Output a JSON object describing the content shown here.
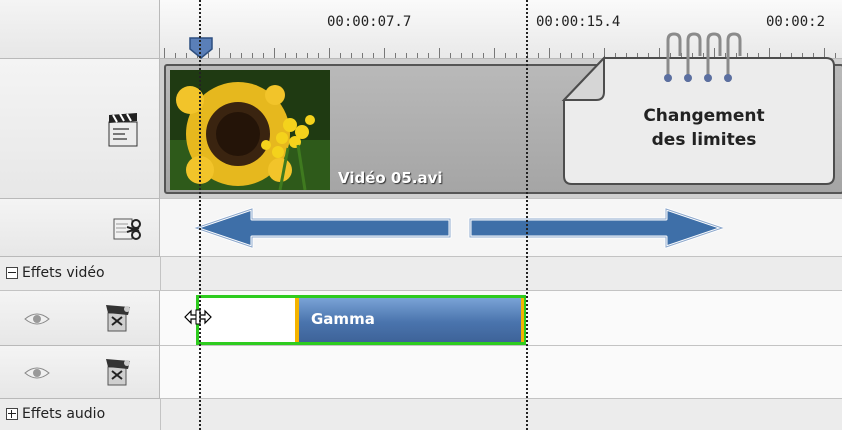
{
  "ruler": {
    "times": [
      "00:00:07.7",
      "00:00:15.4",
      "00:00:2"
    ]
  },
  "video_track": {
    "clip_label": "Vidéo 05.avi"
  },
  "sections": {
    "video_effects": "Effets vidéo",
    "audio_effects": "Effets audio"
  },
  "effect": {
    "label": "Gamma"
  },
  "callout": {
    "line1": "Changement",
    "line2": "des limites"
  },
  "icons": [
    "clapperboard-icon",
    "scissors-icon",
    "eye-icon",
    "effect-icon",
    "move-cursor-icon"
  ],
  "colors": {
    "accent_blue": "#3e6399",
    "selection_green": "#2ecc1f",
    "arrow_blue": "#3e6fa8"
  }
}
